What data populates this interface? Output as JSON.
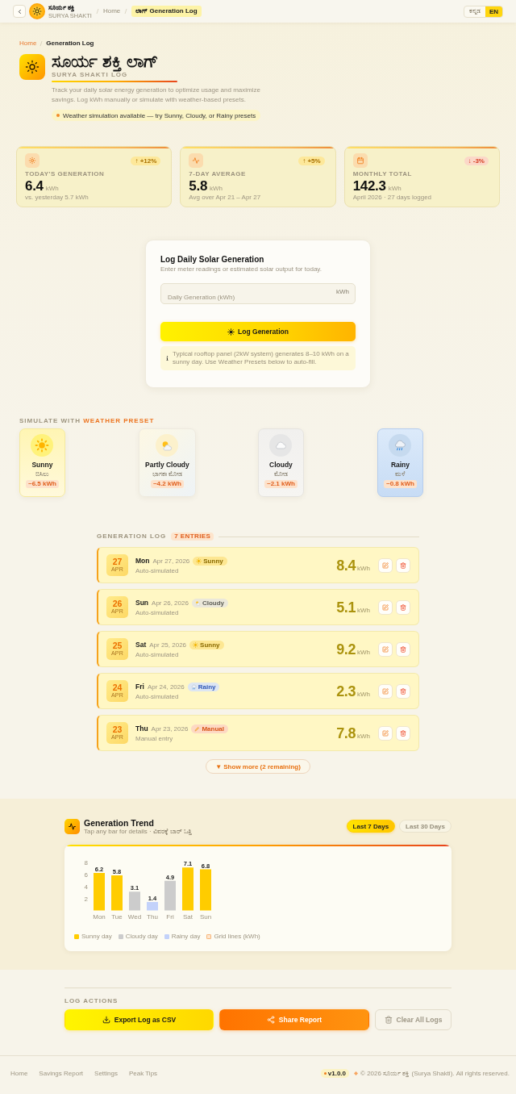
{
  "header": {
    "brand": {
      "name": "ಸೂರ್ಯ ಶಕ್ತಿ",
      "subtitle": "SURYA SHAKTI"
    },
    "nav": [
      {
        "label": "Home",
        "selected": false
      },
      {
        "label": "ಲಾಗ್ Generation Log",
        "selected": true
      }
    ],
    "languages": [
      {
        "label": "ಕನ್ನಡ",
        "selected": false
      },
      {
        "label": "EN",
        "selected": true
      }
    ]
  },
  "hero": {
    "breadcrumb": [
      {
        "label": "Home",
        "selected": false
      },
      {
        "label": "Generation Log",
        "selected": true
      }
    ],
    "title": "ಸೂರ್ಯ ಶಕ್ತಿ ಲಾಗ್",
    "subtitle": "SURYA SHAKTI LOG",
    "description": "Track your daily solar energy generation to optimize usage and maximize savings. Log kWh manually or simulate with weather-based presets.",
    "notice": "Weather simulation available — try Sunny, Cloudy, or Rainy presets"
  },
  "stats": [
    {
      "kind": "sun",
      "label": "TODAY'S GENERATION",
      "value": "6.4",
      "unit": "kWh",
      "note": "vs. yesterday 5.7 kWh",
      "change": "↑ +12%",
      "negative": false
    },
    {
      "kind": "pulse",
      "label": "7-DAY AVERAGE",
      "value": "5.8",
      "unit": "kWh",
      "note": "Avg over Apr 21 – Apr 27",
      "change": "↑ +5%",
      "negative": false
    },
    {
      "kind": "calendar",
      "label": "MONTHLY TOTAL",
      "value": "142.3",
      "unit": "kWh",
      "note": "April 2026 · 27 days logged",
      "change": "↓ -3%",
      "negative": true
    }
  ],
  "form": {
    "title": "Log Daily Solar Generation",
    "subtitle": "Enter meter readings or estimated solar output for today.",
    "field": {
      "placeholder": "Daily Generation (kWh)",
      "suffix": "kWh"
    },
    "submit": "Log Generation",
    "hint": "Typical rooftop panel (2kW system) generates 8–10 kWh on a sunny day. Use Weather Presets below to auto-fill."
  },
  "presets": {
    "heading": "SIMULATE WITH",
    "heading_accent": "WEATHER PRESET",
    "items": [
      {
        "kind": "sunny",
        "name": "Sunny",
        "local_name": "ಬಿಸಿಲು",
        "estimate": "~6.5 kWh"
      },
      {
        "kind": "partly_cloudy",
        "name": "Partly Cloudy",
        "local_name": "ಭಾಗಶಃ ಮೋಡ",
        "estimate": "~4.2 kWh"
      },
      {
        "kind": "cloudy",
        "name": "Cloudy",
        "local_name": "ಮೋಡ",
        "estimate": "~2.1 kWh"
      },
      {
        "kind": "rainy",
        "name": "Rainy",
        "local_name": "ಮಳೆ",
        "estimate": "~0.8 kWh"
      }
    ]
  },
  "log": {
    "title": "GENERATION LOG",
    "count": "7 ENTRIES",
    "entries": [
      {
        "day_number": "27",
        "month": "APR",
        "weekday": "Mon",
        "date": "Apr 27, 2026",
        "weather": {
          "kind": "sunny",
          "label": "Sunny"
        },
        "source": "Auto-simulated",
        "value": "8.4",
        "unit": "kWh"
      },
      {
        "day_number": "26",
        "month": "APR",
        "weekday": "Sun",
        "date": "Apr 26, 2026",
        "weather": {
          "kind": "cloudy",
          "label": "Cloudy"
        },
        "source": "Auto-simulated",
        "value": "5.1",
        "unit": "kWh"
      },
      {
        "day_number": "25",
        "month": "APR",
        "weekday": "Sat",
        "date": "Apr 25, 2026",
        "weather": {
          "kind": "sunny",
          "label": "Sunny"
        },
        "source": "Auto-simulated",
        "value": "9.2",
        "unit": "kWh"
      },
      {
        "day_number": "24",
        "month": "APR",
        "weekday": "Fri",
        "date": "Apr 24, 2026",
        "weather": {
          "kind": "rainy",
          "label": "Rainy"
        },
        "source": "Auto-simulated",
        "value": "2.3",
        "unit": "kWh"
      },
      {
        "day_number": "23",
        "month": "APR",
        "weekday": "Thu",
        "date": "Apr 23, 2026",
        "weather": {
          "kind": "manual",
          "label": "Manual"
        },
        "source": "Manual entry",
        "value": "7.8",
        "unit": "kWh"
      }
    ],
    "show_more": "▼ Show more (2 remaining)"
  },
  "trend": {
    "title": "Generation Trend",
    "subtitle": "Tap any bar for details · ವಿವರಕ್ಕೆ ಬಾರ್ ಒತ್ತಿ",
    "ranges": [
      {
        "label": "Last 7 Days",
        "selected": true
      },
      {
        "label": "Last 30 Days",
        "selected": false
      }
    ],
    "chart_data": {
      "type": "bar",
      "categories": [
        "Mon",
        "Tue",
        "Wed",
        "Thu",
        "Fri",
        "Sat",
        "Sun"
      ],
      "series": [
        {
          "name": "Sunny day",
          "color": "#ffcc00",
          "values": [
            6.2,
            5.8,
            null,
            null,
            null,
            7.1,
            6.8
          ]
        },
        {
          "name": "Cloudy day",
          "color": "#cccccc",
          "values": [
            null,
            null,
            3.1,
            null,
            4.9,
            null,
            null
          ]
        },
        {
          "name": "Rainy day",
          "color": "#c3d2fa",
          "values": [
            null,
            null,
            null,
            1.4,
            null,
            null,
            null
          ]
        }
      ],
      "ylim": [
        0,
        8
      ],
      "yticks": [
        2,
        4,
        6,
        8
      ],
      "stacked": true,
      "data_labels": true
    },
    "grid_legend": "Grid lines (kWh)"
  },
  "actions": {
    "title": "LOG ACTIONS",
    "buttons": [
      {
        "kind": "export",
        "label": "Export Log as CSV"
      },
      {
        "kind": "share",
        "label": "Share Report"
      },
      {
        "kind": "clear",
        "label": "Clear All Logs"
      }
    ]
  },
  "footer": {
    "links": [
      "Home",
      "Savings Report",
      "Settings",
      "Peak Tips"
    ],
    "version": "v1.0.0",
    "copyright": "© 2026 ಸೂರ್ಯ ಶಕ್ತಿ (Surya Shakti). All rights reserved."
  }
}
